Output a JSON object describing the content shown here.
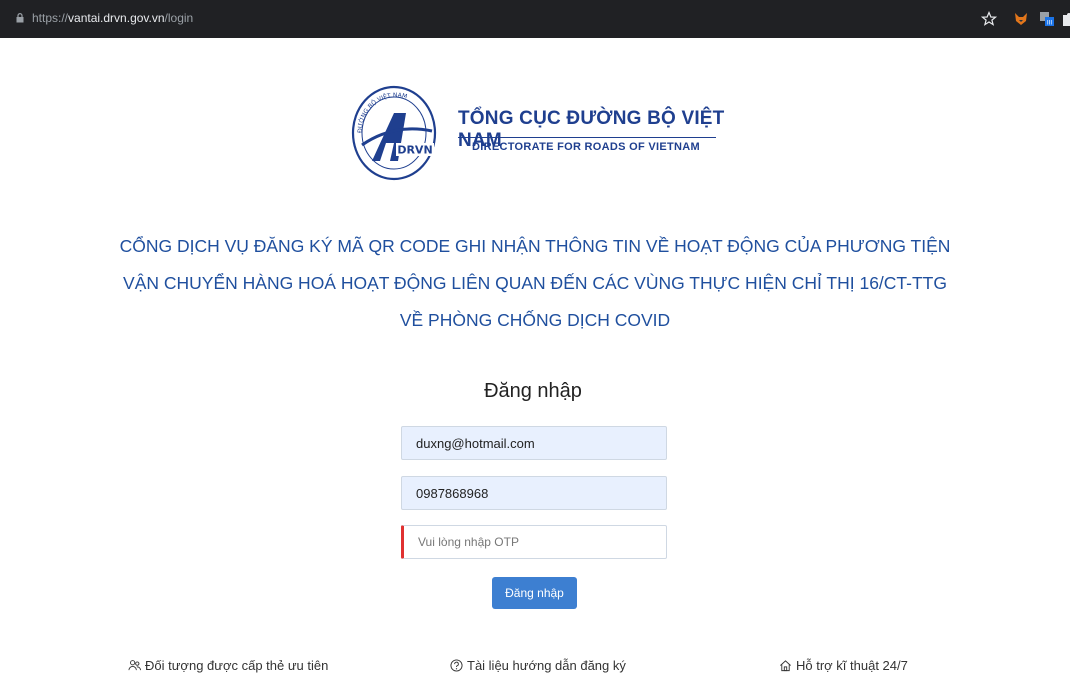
{
  "browser": {
    "url_scheme": "https://",
    "url_host": "vantai.drvn.gov.vn",
    "url_path": "/login",
    "icons": [
      "lock-icon",
      "star-icon",
      "fox-extension-icon",
      "translate-extension-icon",
      "puzzle-extension-icon"
    ]
  },
  "logo": {
    "badge_top_text": "ĐƯỜNG BỘ VIỆT NAM",
    "badge_text": "DRVN",
    "title_vn": "TỔNG CỤC ĐƯỜNG BỘ VIỆT NAM",
    "title_en": "DIRECTORATE FOR ROADS OF VIETNAM"
  },
  "headline": {
    "line1": "CỔNG DỊCH VỤ ĐĂNG KÝ MÃ QR CODE GHI NHẬN THÔNG TIN VỀ HOẠT ĐỘNG CỦA PHƯƠNG TIỆN",
    "line2": "VẬN CHUYỂN HÀNG HOÁ HOẠT ĐỘNG LIÊN QUAN ĐẾN CÁC VÙNG THỰC HIỆN CHỈ THỊ 16/CT-TTG",
    "line3": "VỀ PHÒNG CHỐNG DỊCH COVID"
  },
  "login": {
    "title": "Đăng nhập",
    "email_value": "duxng@hotmail.com",
    "phone_value": "0987868968",
    "otp_placeholder": "Vui lòng nhập OTP",
    "submit_label": "Đăng nhập"
  },
  "footer": {
    "priority": "Đối tượng được cấp thẻ ưu tiên",
    "guide": "Tài liệu hướng dẫn đăng ký",
    "support": "Hỗ trợ kĩ thuật 24/7"
  },
  "colors": {
    "brand_blue": "#1f3f8f",
    "headline_blue": "#1f4f9e",
    "button_blue": "#3d7fd1",
    "input_fill": "#e8f0fe",
    "error_red": "#e03131"
  }
}
